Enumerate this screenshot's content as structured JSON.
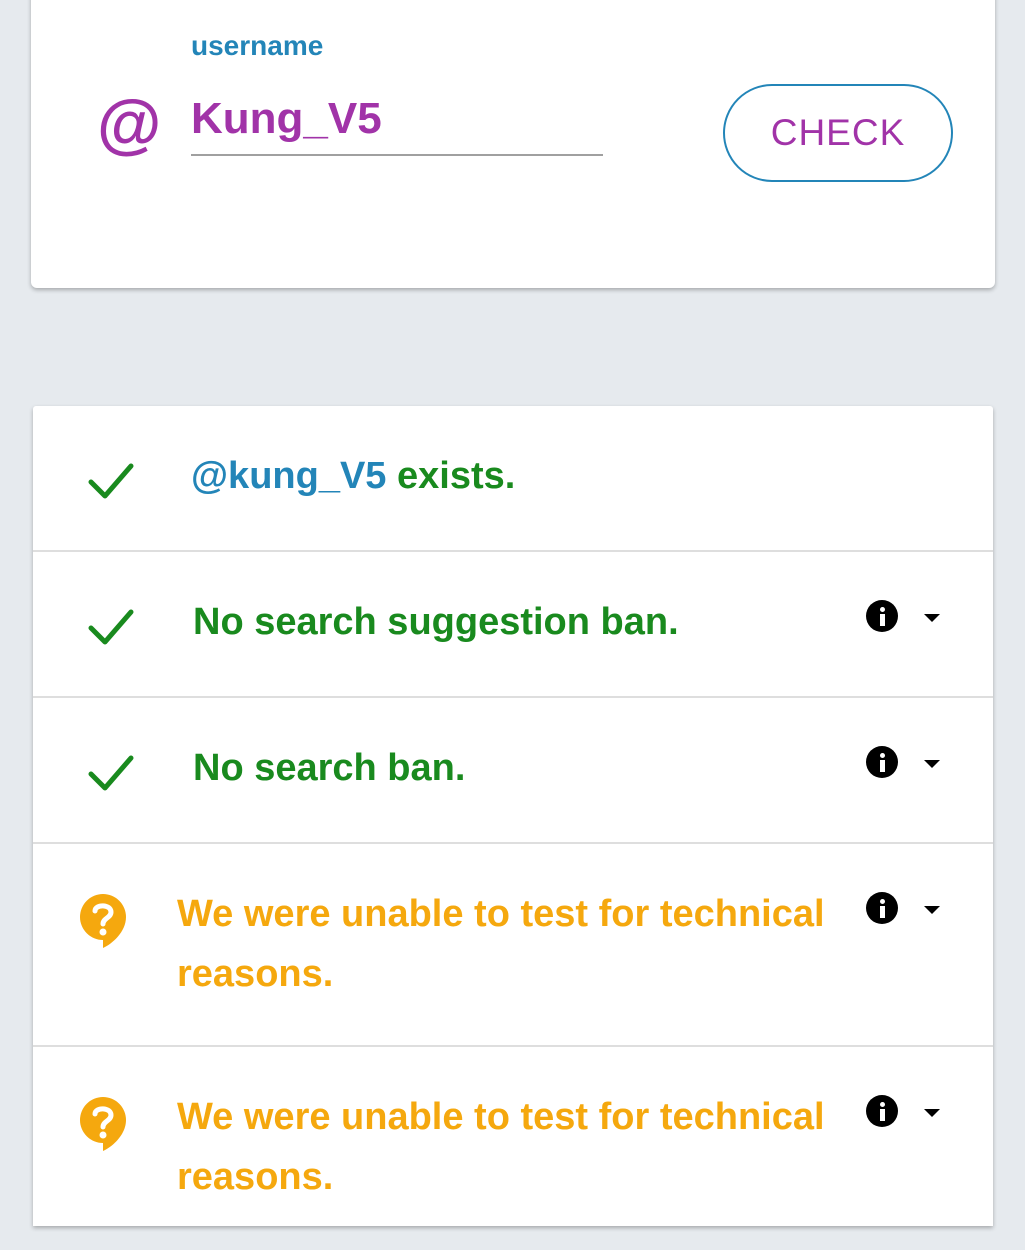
{
  "search": {
    "label": "username",
    "at_symbol": "@",
    "value": "Kung_V5",
    "button_label": "CHECK"
  },
  "results": {
    "rows": [
      {
        "status": "pass",
        "icon": "checkmark-icon",
        "prefix": "@kung_V5",
        "text": " exists."
      },
      {
        "status": "pass",
        "icon": "checkmark-icon",
        "text": "No search suggestion ban."
      },
      {
        "status": "pass",
        "icon": "checkmark-icon",
        "text": "No search ban."
      },
      {
        "status": "unknown",
        "icon": "question-bubble-icon",
        "text": "We were unable to test for technical reasons."
      },
      {
        "status": "unknown",
        "icon": "question-bubble-icon",
        "text": "We were unable to test for technical reasons."
      }
    ]
  },
  "colors": {
    "accent_purple": "#a133a8",
    "accent_blue": "#2385b8",
    "pass_green": "#198a1e",
    "unknown_amber": "#f5a80e",
    "background": "#e6eaee"
  }
}
